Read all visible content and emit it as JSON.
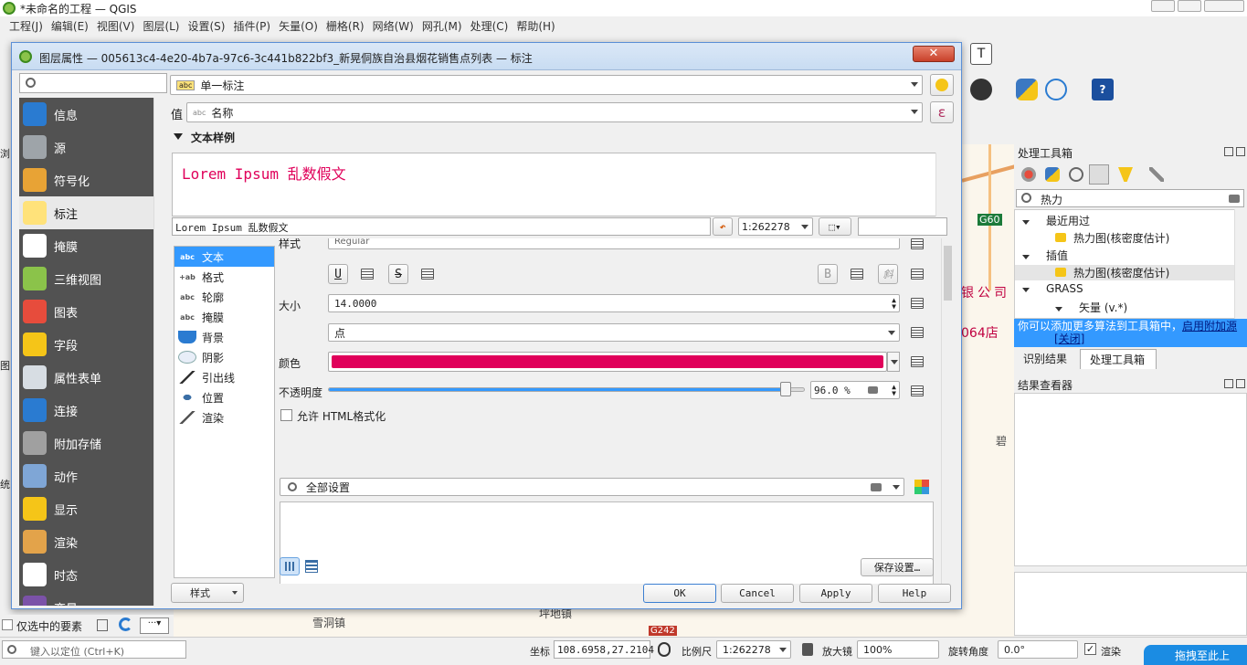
{
  "app": {
    "title": "*未命名的工程 — QGIS"
  },
  "menu": [
    "工程(J)",
    "编辑(E)",
    "视图(V)",
    "图层(L)",
    "设置(S)",
    "插件(P)",
    "矢量(O)",
    "栅格(R)",
    "网络(W)",
    "网孔(M)",
    "处理(C)",
    "帮助(H)"
  ],
  "dialog": {
    "title": "图层属性 — 005613c4-4e20-4b7a-97c6-3c441b822bf3_新晃侗族自治县烟花销售点列表 — 标注",
    "search_placeholder": "",
    "nav": [
      {
        "label": "信息",
        "icon": "info-icon"
      },
      {
        "label": "源",
        "icon": "source-icon"
      },
      {
        "label": "符号化",
        "icon": "symbology-icon"
      },
      {
        "label": "标注",
        "icon": "labels-icon"
      },
      {
        "label": "掩膜",
        "icon": "mask-icon"
      },
      {
        "label": "三维视图",
        "icon": "3d-view-icon"
      },
      {
        "label": "图表",
        "icon": "diagram-icon"
      },
      {
        "label": "字段",
        "icon": "fields-icon"
      },
      {
        "label": "属性表单",
        "icon": "attribute-form-icon"
      },
      {
        "label": "连接",
        "icon": "join-icon"
      },
      {
        "label": "附加存储",
        "icon": "storage-icon"
      },
      {
        "label": "动作",
        "icon": "actions-icon"
      },
      {
        "label": "显示",
        "icon": "display-icon"
      },
      {
        "label": "渲染",
        "icon": "rendering-icon"
      },
      {
        "label": "时态",
        "icon": "temporal-icon"
      },
      {
        "label": "变量",
        "icon": "variables-icon"
      }
    ],
    "label_mode": "单一标注",
    "value_label": "值",
    "value_field": "名称",
    "section_text_sample": "文本样例",
    "preview_text": "Lorem Ipsum 乱数假文",
    "sample_input": "Lorem Ipsum 乱数假文",
    "scale": "1:262278",
    "sub_tabs": [
      {
        "label": "文本",
        "icon": "abc"
      },
      {
        "label": "格式",
        "icon": "+ab"
      },
      {
        "label": "轮廓",
        "icon": "abc"
      },
      {
        "label": "掩膜",
        "icon": "abc"
      },
      {
        "label": "背景",
        "icon": "bg"
      },
      {
        "label": "阴影",
        "icon": "sh"
      },
      {
        "label": "引出线",
        "icon": "co"
      },
      {
        "label": "位置",
        "icon": "pos"
      },
      {
        "label": "渲染",
        "icon": "rnd"
      }
    ],
    "style_label": "样式",
    "style_value": "Regular",
    "underline": "U",
    "strike": "S",
    "bold": "B",
    "size_label": "大小",
    "size_value": "14.0000",
    "unit_value": "点",
    "color_label": "颜色",
    "text_color": "#e0005a",
    "opacity_label": "不透明度",
    "opacity_value": "96.0 %",
    "opacity_fraction": 0.96,
    "html_label": "允许 HTML格式化",
    "settings_search": "全部设置",
    "save_settings": "保存设置…",
    "bottom_style": "样式",
    "ok": "OK",
    "cancel": "Cancel",
    "apply": "Apply",
    "help": "Help"
  },
  "processing": {
    "title": "处理工具箱",
    "search": "热力",
    "tree": [
      {
        "label": "最近用过",
        "level": 0
      },
      {
        "label": "热力图(核密度估计)",
        "level": 1
      },
      {
        "label": "插值",
        "level": 0
      },
      {
        "label": "热力图(核密度估计)",
        "level": 1
      },
      {
        "label": "GRASS",
        "level": 0
      },
      {
        "label": "矢量 (v.*)",
        "level": 1
      }
    ],
    "notice": "你可以添加更多算法到工具箱中，",
    "notice_link": "启用附加源",
    "notice_close": "[关闭]",
    "tab_identify": "识别结果",
    "tab_toolbox": "处理工具箱",
    "results_title": "结果查看器"
  },
  "map": {
    "labels": [
      "G60",
      "银公司",
      "064店",
      "碧",
      "雪洞镇",
      "坪地镇",
      "G242"
    ]
  },
  "left_panels": {
    "browse": "浏",
    "stats": "统",
    "layers": "图"
  },
  "status": {
    "selected_only": "仅选中的要素",
    "locate_placeholder": "键入以定位 (Ctrl+K)",
    "coord_label": "坐标",
    "coord_value": "108.6958,27.2104",
    "scale_label": "比例尺",
    "scale_value": "1:262278",
    "magnifier_label": "放大镜",
    "magnifier_value": "100%",
    "rotation_label": "旋转角度",
    "rotation_value": "0.0°",
    "render_label": "渲染",
    "bubble": "拖拽至此上"
  }
}
